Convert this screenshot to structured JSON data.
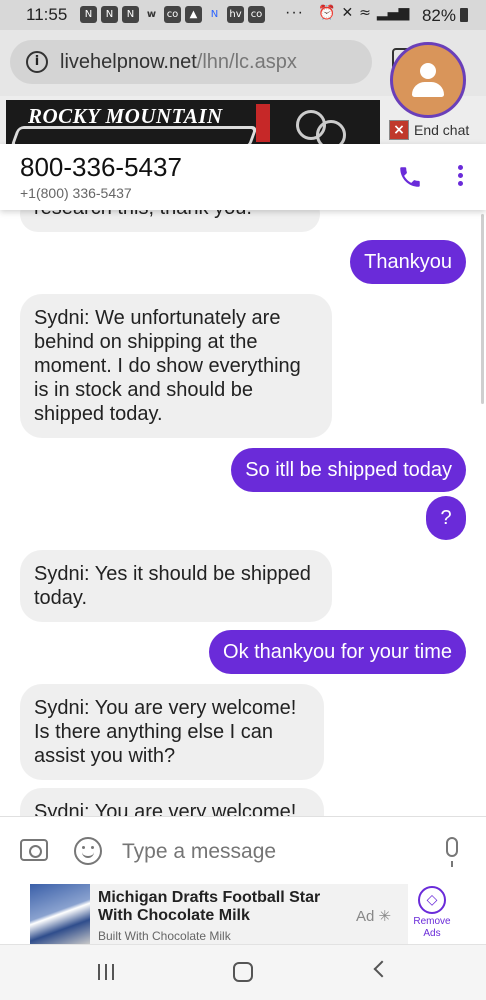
{
  "status_bar": {
    "time": "11:55",
    "battery": "82%",
    "overflow": "···"
  },
  "browser": {
    "url_host": "livehelpnow.net",
    "url_path": "/lhn/lc.aspx"
  },
  "banner": {
    "brand": "ROCKY MOUNTAIN",
    "end_chat_label": "End chat"
  },
  "contact": {
    "title": "800-336-5437",
    "subtitle": "+1(800) 336-5437"
  },
  "messages": [
    {
      "dir": "in",
      "text": "research this, thank you."
    },
    {
      "dir": "out",
      "text": "Thankyou"
    },
    {
      "dir": "in",
      "text": "Sydni: We unfortunately are behind on shipping at the moment. I do show everything is in stock and should  be shipped today."
    },
    {
      "dir": "out",
      "text": "So itll be shipped today"
    },
    {
      "dir": "out",
      "text": "?"
    },
    {
      "dir": "in",
      "text": "Sydni: Yes it should be shipped today."
    },
    {
      "dir": "out",
      "text": "Ok thankyou for your time"
    },
    {
      "dir": "in",
      "text": "Sydni: You are very welcome! Is there anything else I can assist you with?"
    },
    {
      "dir": "in",
      "text": "Sydni: You are very welcome!"
    }
  ],
  "composer": {
    "placeholder": "Type a message"
  },
  "bottom_ad": {
    "headline": "Michigan Drafts Football Star With Chocolate Milk",
    "byline": "Built With Chocolate Milk",
    "ad_label": "Ad",
    "remove_label": "Remove Ads"
  },
  "colors": {
    "accent": "#6a2bd9",
    "incoming_bubble": "#efefef",
    "avatar_bg": "#d9955a"
  },
  "icons": {
    "status_notifications": [
      "n-icon",
      "n-icon",
      "n-icon",
      "w-icon",
      "co-icon",
      "hat-icon",
      "n-icon",
      "hv-icon",
      "co-icon"
    ],
    "system": [
      "alarm-icon",
      "mute-icon",
      "wifi-icon",
      "signal-icon"
    ]
  }
}
